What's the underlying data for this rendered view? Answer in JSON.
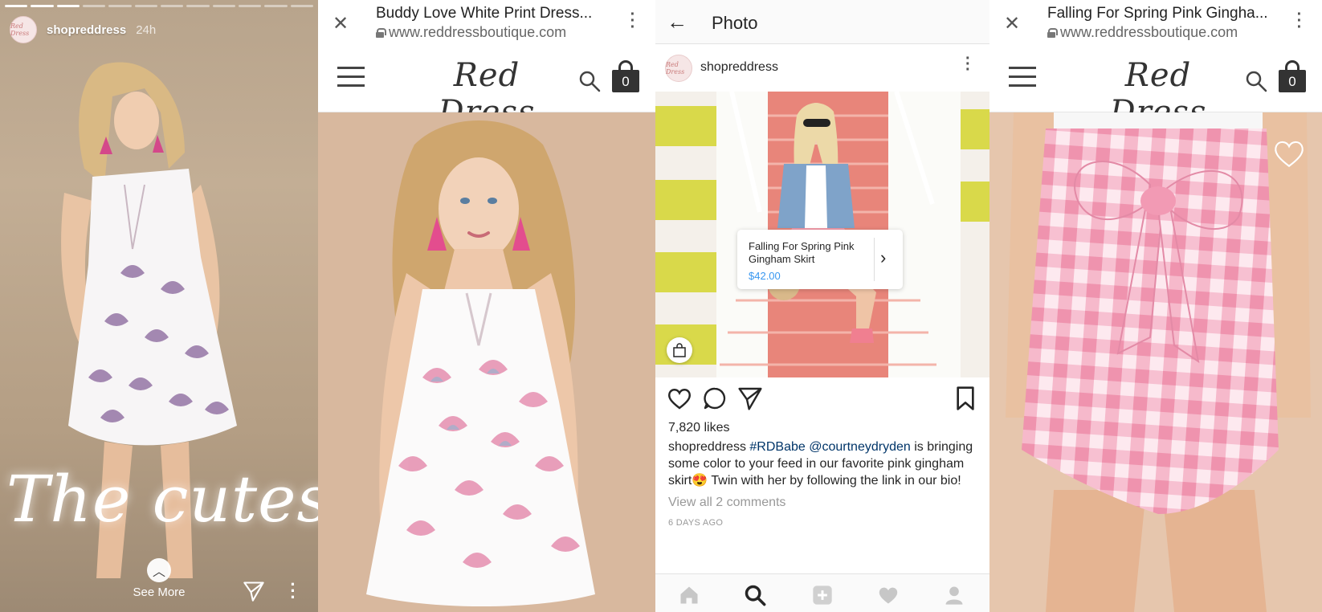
{
  "story": {
    "username": "shopreddress",
    "time": "24h",
    "overlay_text": "The cutest",
    "see_more": "See More",
    "avatar_text": "Red Dress",
    "progress_total": 12,
    "progress_done": 3
  },
  "browser_dress": {
    "title": "Buddy Love White Print Dress...",
    "url": "www.reddressboutique.com",
    "logo": "Red Dress",
    "cart_count": "0"
  },
  "instagram": {
    "header_title": "Photo",
    "username": "shopreddress",
    "avatar_text": "Red Dress",
    "tag_product_name": "Falling For Spring Pink Gingham Skirt",
    "tag_price": "$42.00",
    "likes": "7,820 likes",
    "caption_user": "shopreddress",
    "caption_hashtag": "#RDBabe",
    "caption_mention": "@courtneydryden",
    "caption_text": "is bringing some color to your feed in our favorite pink gingham skirt😍 Twin with her by following the link in our bio!",
    "view_comments": "View all 2 comments",
    "time_ago": "6 DAYS AGO"
  },
  "browser_skirt": {
    "title": "Falling For Spring Pink Gingha...",
    "url": "www.reddressboutique.com",
    "logo": "Red Dress",
    "cart_count": "0"
  },
  "colors": {
    "link_blue": "#3897f0",
    "hashtag_navy": "#003569",
    "gingham_pink": "#f2a9c0",
    "shell_pink": "#e58fb0",
    "stairs_coral": "#e8857a",
    "stripe_yellow": "#d9d94a"
  },
  "icons": [
    "close-icon",
    "lock-icon",
    "kebab-icon",
    "hamburger-icon",
    "search-icon",
    "bag-icon",
    "back-arrow-icon",
    "heart-icon",
    "comment-icon",
    "send-icon",
    "bookmark-icon",
    "home-icon",
    "add-icon",
    "profile-icon",
    "chevron-up-icon",
    "chevron-right-icon",
    "shopping-bag-icon"
  ]
}
